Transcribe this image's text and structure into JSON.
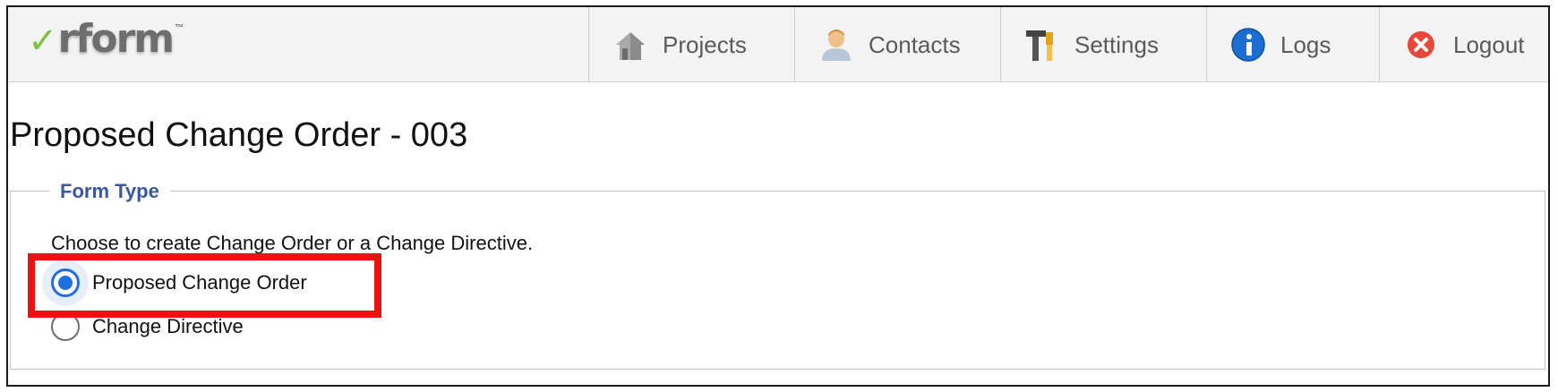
{
  "header": {
    "logo_text": "rform",
    "logo_check": "✓",
    "logo_tm": "™",
    "nav": [
      {
        "label": "Projects",
        "icon": "house-icon"
      },
      {
        "label": "Contacts",
        "icon": "person-icon"
      },
      {
        "label": "Settings",
        "icon": "tools-icon"
      },
      {
        "label": "Logs",
        "icon": "info-icon"
      },
      {
        "label": "Logout",
        "icon": "close-circle-icon"
      }
    ]
  },
  "page": {
    "title": "Proposed Change Order - 003"
  },
  "form_type": {
    "legend": "Form Type",
    "instructions": "Choose to create Change Order or a Change Directive.",
    "options": [
      {
        "label": "Proposed Change Order",
        "selected": true
      },
      {
        "label": "Change Directive",
        "selected": false
      }
    ]
  },
  "colors": {
    "accent": "#1f6fde",
    "legend": "#3a57a1",
    "highlight": "#ee1111",
    "logo_check": "#7cc242"
  }
}
